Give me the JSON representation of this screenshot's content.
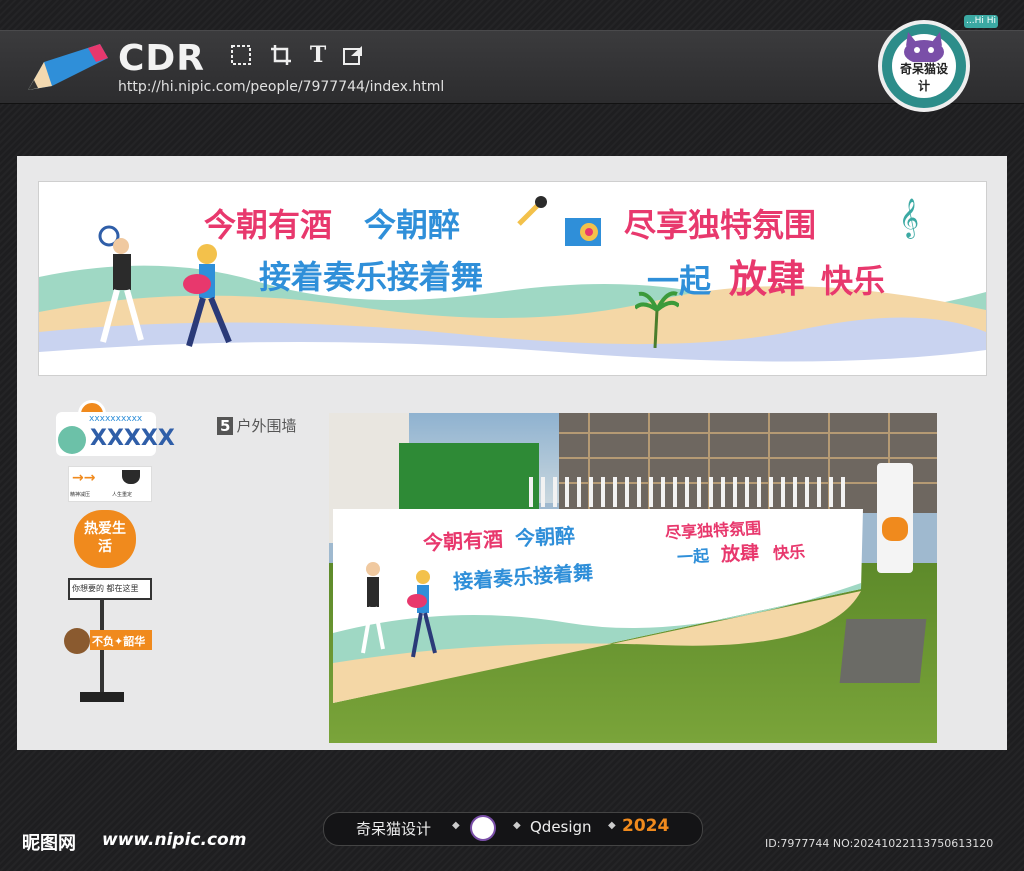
{
  "header": {
    "brand": "CDR",
    "url": "http://hi.nipic.com/people/7977744/index.html",
    "hi_label": "...Hi Hi",
    "badge_text": "奇呆猫设计"
  },
  "banner": {
    "line1a": "今朝有酒",
    "line1b": "今朝醉",
    "line2": "接着奏乐接着舞",
    "line3": "尽享独特氛围",
    "line4a": "一起",
    "line4b": "放肆",
    "line4c": "快乐"
  },
  "sign": {
    "top_small": "xxxxxxxxxx",
    "top_big": "XXXXX",
    "left_tiny": "精神减压",
    "right_tiny": "人生重定",
    "flower": "热爱生活",
    "arrow": "你想要的 都在这里",
    "bottom": "不负✦韶华"
  },
  "section_label": {
    "num": "5",
    "text": "户外围墙"
  },
  "footer": {
    "left_logo": "昵图网",
    "left_url": "www.nipic.com",
    "pill_left": "奇呆猫设计",
    "pill_mid": "Qdesign",
    "pill_year": "2024",
    "id_text": "ID:7977744 NO:20241022113750613120"
  },
  "colors": {
    "pink": "#e8386d",
    "blue": "#2f8fd9",
    "orange": "#f08a1d",
    "teal": "#2d8d8a"
  }
}
